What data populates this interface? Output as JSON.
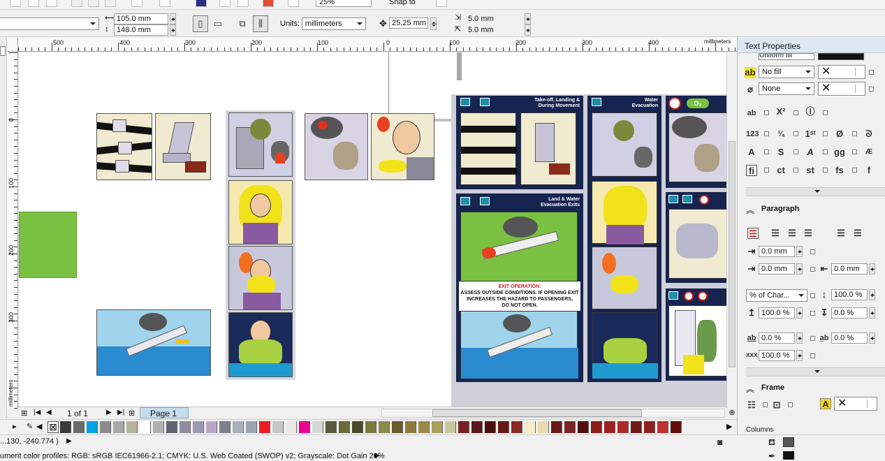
{
  "toolbar_top": {
    "zoom_value": "25%",
    "snap_label": "Snap to"
  },
  "property_bar": {
    "width_value": "105.0 mm",
    "height_value": "148.0 mm",
    "units_label": "Units:",
    "units_value": "millimeters",
    "nudge_value": "25.25 mm",
    "dup_x_value": "5.0 mm",
    "dup_y_value": "5.0 mm"
  },
  "rulers": {
    "unit_label": "millimeters",
    "h_ticks": [
      "500",
      "400",
      "300",
      "200",
      "100",
      "0",
      "100",
      "200",
      "300",
      "400"
    ],
    "v_ticks": [
      "0",
      "100",
      "200",
      "300"
    ],
    "v_unit_label": "millimeters"
  },
  "canvas": {
    "card_left": {
      "header1_line1": "Take-off, Landing &",
      "header1_line2": "During Movement",
      "header2_line1": "Land & Water",
      "header2_line2": "Evacuation Exits",
      "exit_title": "EXIT OPERATION:",
      "exit_text1": "ASSESS OUTSIDE CONDITIONS. IF OPENING EXIT",
      "exit_text2": "INCREASES THE HAZARD TO PASSENGERS,",
      "exit_text3": "DO NOT OPEN."
    },
    "card_right": {
      "header_line1": "Water",
      "header_line2": "Evacuation",
      "o2_label": "O₂"
    }
  },
  "navigator": {
    "page_count": "1 of 1",
    "page_tab": "Page 1"
  },
  "palette": {
    "colors": [
      "#3b3b3b",
      "#6b6b6b",
      "#00a3e0",
      "#8c8c8c",
      "#a8a8a8",
      "#b4b49a",
      "#ffffff",
      "#b0b0b0",
      "#5f6570",
      "#8e8e9b",
      "#9b9bb0",
      "#b8a8c8",
      "#7f7f8a",
      "#aab0b8",
      "#9aa3b0",
      "#ed1c24",
      "#c8c8c8",
      "#e8e8e8",
      "#ec008c",
      "#d8d8d8",
      "#5a5a3a",
      "#6b6b3a",
      "#4a4a2a",
      "#7a7a3a",
      "#8a8a4a",
      "#6a5a2a",
      "#8b7a3a",
      "#9b8a4a",
      "#aba05a",
      "#c8c89a",
      "#7a2020",
      "#5a1818",
      "#4a1010",
      "#6a1818",
      "#8a2828",
      "#f5ecc8",
      "#e8dcb0",
      "#6b1a1a",
      "#7a2222",
      "#501010",
      "#8b1a1a",
      "#a02020",
      "#b02828",
      "#701818",
      "#902020",
      "#c03030",
      "#600a0a"
    ]
  },
  "status": {
    "coords": "...130, -240.774 )",
    "color_profiles": "ument color profiles: RGB: sRGB IEC61966-2.1; CMYK: U.S. Web Coated (SWOP) v2; Grayscale: Dot Gain 20%"
  },
  "docker": {
    "title": "Text Properties",
    "fill_top_value": "Uniform fill",
    "bg_fill_value": "No fill",
    "outline_value": "None",
    "paragraph_label": "Paragraph",
    "indent_first": "0.0 mm",
    "indent_left": "0.0 mm",
    "indent_right": "0.0 mm",
    "line_spacing_unit": "% of Char...",
    "line_spacing": "100.0 %",
    "before_para": "100.0 %",
    "after_para": "0.0 %",
    "char_spacing": "0.0 %",
    "word_spacing": "0.0 %",
    "lang_spacing": "100.0 %",
    "frame_label": "Frame",
    "columns_label": "Columns"
  }
}
